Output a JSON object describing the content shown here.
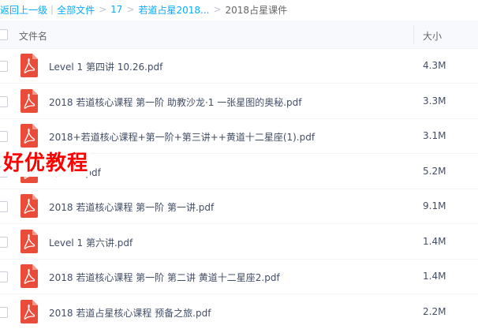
{
  "breadcrumb": {
    "back": "返回上一级",
    "all_files": "全部文件",
    "crumb_1": "17",
    "crumb_2": "若道占星2018...",
    "current": "2018占星课件"
  },
  "table": {
    "col_name": "文件名",
    "col_size": "大小"
  },
  "files": [
    {
      "name": "Level 1 第四讲 10.26.pdf",
      "size": "4.3M",
      "icon": "pdf-icon"
    },
    {
      "name": "2018 若道核心课程 第一阶 助教沙龙·1 一张星图的奥秘.pdf",
      "size": "3.3M",
      "icon": "pdf-icon"
    },
    {
      "name": "2018+若道核心课程+第一阶+第三讲++黄道十二星座(1).pdf",
      "size": "3.1M",
      "icon": "pdf-icon"
    },
    {
      "name": "讲 11.2.pdf",
      "size": "5.2M",
      "icon": "pdf-icon"
    },
    {
      "name": "2018 若道核心课程 第一阶 第一讲.pdf",
      "size": "9.1M",
      "icon": "pdf-icon"
    },
    {
      "name": "Level 1 第六讲.pdf",
      "size": "1.4M",
      "icon": "pdf-icon"
    },
    {
      "name": "2018 若道核心课程 第一阶 第二讲 黄道十二星座2.pdf",
      "size": "1.4M",
      "icon": "pdf-icon"
    },
    {
      "name": "2018 若道占星核心课程 预备之旅.pdf",
      "size": "2.2M",
      "icon": "pdf-icon"
    }
  ],
  "watermark": "好优教程",
  "colors": {
    "link": "#09aaff",
    "pdf_red": "#ea4c3a",
    "text": "#424e67",
    "watermark": "#ff0000"
  }
}
